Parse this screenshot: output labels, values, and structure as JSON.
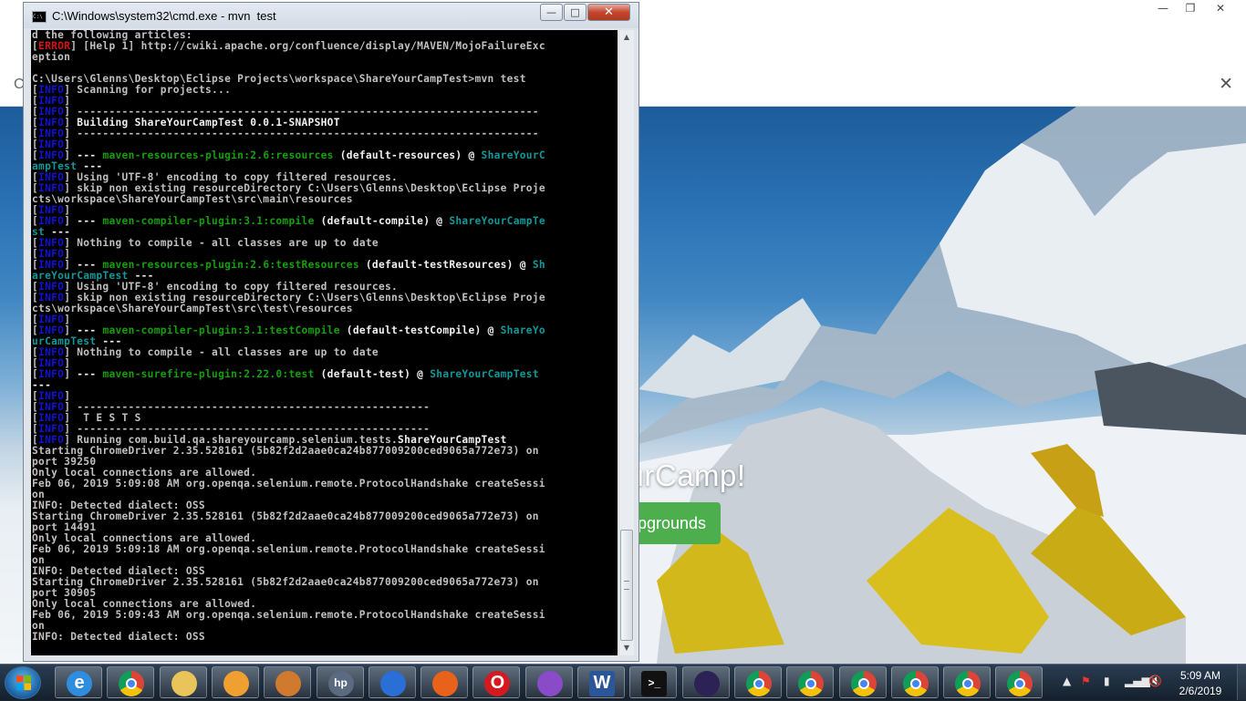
{
  "chrome": {
    "hero_title": "areYourCamp!",
    "hero_button": "pgrounds"
  },
  "cmd": {
    "title": "C:\\Windows\\system32\\cmd.exe - mvn  test",
    "lines": [
      [
        {
          "t": "d the following articles:"
        }
      ],
      [
        {
          "t": "["
        },
        {
          "c": "err",
          "t": "ERROR"
        },
        {
          "t": "] [Help 1] http://cwiki.apache.org/confluence/display/MAVEN/MojoFailureExc"
        }
      ],
      [
        {
          "t": "eption"
        }
      ],
      [
        {
          "t": ""
        }
      ],
      [
        {
          "t": "C:\\Users\\Glenns\\Desktop\\Eclipse Projects\\workspace\\ShareYourCampTest>mvn test"
        }
      ],
      [
        {
          "t": "["
        },
        {
          "c": "info",
          "t": "INFO"
        },
        {
          "t": "] Scanning for projects..."
        }
      ],
      [
        {
          "t": "["
        },
        {
          "c": "info",
          "t": "INFO"
        },
        {
          "t": "]"
        }
      ],
      [
        {
          "t": "["
        },
        {
          "c": "info",
          "t": "INFO"
        },
        {
          "t": "] ------------------------------------------------------------------------"
        }
      ],
      [
        {
          "t": "["
        },
        {
          "c": "info",
          "t": "INFO"
        },
        {
          "t": "] "
        },
        {
          "c": "white",
          "t": "Building ShareYourCampTest 0.0.1-SNAPSHOT"
        }
      ],
      [
        {
          "t": "["
        },
        {
          "c": "info",
          "t": "INFO"
        },
        {
          "t": "] ------------------------------------------------------------------------"
        }
      ],
      [
        {
          "t": "["
        },
        {
          "c": "info",
          "t": "INFO"
        },
        {
          "t": "]"
        }
      ],
      [
        {
          "t": "["
        },
        {
          "c": "info",
          "t": "INFO"
        },
        {
          "t": "] "
        },
        {
          "c": "white",
          "t": "--- "
        },
        {
          "c": "green",
          "t": "maven-resources-plugin:2.6:resources"
        },
        {
          "c": "white",
          "t": " (default-resources) @ "
        },
        {
          "c": "cyan",
          "t": "ShareYourC"
        }
      ],
      [
        {
          "c": "cyan",
          "t": "ampTest"
        },
        {
          "c": "white",
          "t": " ---"
        }
      ],
      [
        {
          "t": "["
        },
        {
          "c": "info",
          "t": "INFO"
        },
        {
          "t": "] Using 'UTF-8' encoding to copy filtered resources."
        }
      ],
      [
        {
          "t": "["
        },
        {
          "c": "info",
          "t": "INFO"
        },
        {
          "t": "] skip non existing resourceDirectory C:\\Users\\Glenns\\Desktop\\Eclipse Proje"
        }
      ],
      [
        {
          "t": "cts\\workspace\\ShareYourCampTest\\src\\main\\resources"
        }
      ],
      [
        {
          "t": "["
        },
        {
          "c": "info",
          "t": "INFO"
        },
        {
          "t": "]"
        }
      ],
      [
        {
          "t": "["
        },
        {
          "c": "info",
          "t": "INFO"
        },
        {
          "t": "] "
        },
        {
          "c": "white",
          "t": "--- "
        },
        {
          "c": "green",
          "t": "maven-compiler-plugin:3.1:compile"
        },
        {
          "c": "white",
          "t": " (default-compile) @ "
        },
        {
          "c": "cyan",
          "t": "ShareYourCampTe"
        }
      ],
      [
        {
          "c": "cyan",
          "t": "st"
        },
        {
          "c": "white",
          "t": " ---"
        }
      ],
      [
        {
          "t": "["
        },
        {
          "c": "info",
          "t": "INFO"
        },
        {
          "t": "] Nothing to compile - all classes are up to date"
        }
      ],
      [
        {
          "t": "["
        },
        {
          "c": "info",
          "t": "INFO"
        },
        {
          "t": "]"
        }
      ],
      [
        {
          "t": "["
        },
        {
          "c": "info",
          "t": "INFO"
        },
        {
          "t": "] "
        },
        {
          "c": "white",
          "t": "--- "
        },
        {
          "c": "green",
          "t": "maven-resources-plugin:2.6:testResources"
        },
        {
          "c": "white",
          "t": " (default-testResources) @ "
        },
        {
          "c": "cyan",
          "t": "Sh"
        }
      ],
      [
        {
          "c": "cyan",
          "t": "areYourCampTest"
        },
        {
          "c": "white",
          "t": " ---"
        }
      ],
      [
        {
          "t": "["
        },
        {
          "c": "info",
          "t": "INFO"
        },
        {
          "t": "] Using 'UTF-8' encoding to copy filtered resources."
        }
      ],
      [
        {
          "t": "["
        },
        {
          "c": "info",
          "t": "INFO"
        },
        {
          "t": "] skip non existing resourceDirectory C:\\Users\\Glenns\\Desktop\\Eclipse Proje"
        }
      ],
      [
        {
          "t": "cts\\workspace\\ShareYourCampTest\\src\\test\\resources"
        }
      ],
      [
        {
          "t": "["
        },
        {
          "c": "info",
          "t": "INFO"
        },
        {
          "t": "]"
        }
      ],
      [
        {
          "t": "["
        },
        {
          "c": "info",
          "t": "INFO"
        },
        {
          "t": "] "
        },
        {
          "c": "white",
          "t": "--- "
        },
        {
          "c": "green",
          "t": "maven-compiler-plugin:3.1:testCompile"
        },
        {
          "c": "white",
          "t": " (default-testCompile) @ "
        },
        {
          "c": "cyan",
          "t": "ShareYo"
        }
      ],
      [
        {
          "c": "cyan",
          "t": "urCampTest"
        },
        {
          "c": "white",
          "t": " ---"
        }
      ],
      [
        {
          "t": "["
        },
        {
          "c": "info",
          "t": "INFO"
        },
        {
          "t": "] Nothing to compile - all classes are up to date"
        }
      ],
      [
        {
          "t": "["
        },
        {
          "c": "info",
          "t": "INFO"
        },
        {
          "t": "]"
        }
      ],
      [
        {
          "t": "["
        },
        {
          "c": "info",
          "t": "INFO"
        },
        {
          "t": "] "
        },
        {
          "c": "white",
          "t": "--- "
        },
        {
          "c": "green",
          "t": "maven-surefire-plugin:2.22.0:test"
        },
        {
          "c": "white",
          "t": " (default-test) @ "
        },
        {
          "c": "cyan",
          "t": "ShareYourCampTest"
        }
      ],
      [
        {
          "c": "white",
          "t": "---"
        }
      ],
      [
        {
          "t": "["
        },
        {
          "c": "info",
          "t": "INFO"
        },
        {
          "t": "]"
        }
      ],
      [
        {
          "t": "["
        },
        {
          "c": "info",
          "t": "INFO"
        },
        {
          "t": "] -------------------------------------------------------"
        }
      ],
      [
        {
          "t": "["
        },
        {
          "c": "info",
          "t": "INFO"
        },
        {
          "t": "]  T E S T S"
        }
      ],
      [
        {
          "t": "["
        },
        {
          "c": "info",
          "t": "INFO"
        },
        {
          "t": "] -------------------------------------------------------"
        }
      ],
      [
        {
          "t": "["
        },
        {
          "c": "info",
          "t": "INFO"
        },
        {
          "t": "] Running com.build.qa.shareyourcamp.selenium.tests."
        },
        {
          "c": "white",
          "t": "ShareYourCampTest"
        }
      ],
      [
        {
          "t": "Starting ChromeDriver 2.35.528161 (5b82f2d2aae0ca24b877009200ced9065a772e73) on"
        }
      ],
      [
        {
          "t": "port 39250"
        }
      ],
      [
        {
          "t": "Only local connections are allowed."
        }
      ],
      [
        {
          "t": "Feb 06, 2019 5:09:08 AM org.openqa.selenium.remote.ProtocolHandshake createSessi"
        }
      ],
      [
        {
          "t": "on"
        }
      ],
      [
        {
          "t": "INFO: Detected dialect: OSS"
        }
      ],
      [
        {
          "t": "Starting ChromeDriver 2.35.528161 (5b82f2d2aae0ca24b877009200ced9065a772e73) on"
        }
      ],
      [
        {
          "t": "port 14491"
        }
      ],
      [
        {
          "t": "Only local connections are allowed."
        }
      ],
      [
        {
          "t": "Feb 06, 2019 5:09:18 AM org.openqa.selenium.remote.ProtocolHandshake createSessi"
        }
      ],
      [
        {
          "t": "on"
        }
      ],
      [
        {
          "t": "INFO: Detected dialect: OSS"
        }
      ],
      [
        {
          "t": "Starting ChromeDriver 2.35.528161 (5b82f2d2aae0ca24b877009200ced9065a772e73) on"
        }
      ],
      [
        {
          "t": "port 30905"
        }
      ],
      [
        {
          "t": "Only local connections are allowed."
        }
      ],
      [
        {
          "t": "Feb 06, 2019 5:09:43 AM org.openqa.selenium.remote.ProtocolHandshake createSessi"
        }
      ],
      [
        {
          "t": "on"
        }
      ],
      [
        {
          "t": "INFO: Detected dialect: OSS"
        }
      ],
      [
        {
          "t": ""
        }
      ],
      [
        {
          "cur": true,
          "t": ""
        }
      ]
    ]
  },
  "taskbar": {
    "clock_time": "5:09 AM",
    "clock_date": "2/6/2019",
    "items": [
      {
        "name": "internet-explorer-icon",
        "color": "#2f8de0",
        "glyph": "e"
      },
      {
        "name": "chrome-icon",
        "color": "chrome",
        "glyph": ""
      },
      {
        "name": "file-explorer-icon",
        "color": "#e8c45a",
        "glyph": ""
      },
      {
        "name": "media-player-icon",
        "color": "#f0a030",
        "glyph": ""
      },
      {
        "name": "remote-desktop-icon",
        "color": "#d07a30",
        "glyph": ""
      },
      {
        "name": "hp-icon",
        "color": "#5a6a80",
        "glyph": "hp"
      },
      {
        "name": "firefox-blue-icon",
        "color": "#2a6fd6",
        "glyph": ""
      },
      {
        "name": "firefox-icon",
        "color": "#e8621b",
        "glyph": ""
      },
      {
        "name": "opera-icon",
        "color": "#d41a20",
        "glyph": "O"
      },
      {
        "name": "colorful-app-icon",
        "color": "#8a4bc8",
        "glyph": ""
      },
      {
        "name": "word-icon",
        "color": "#2b579a",
        "glyph": "W"
      },
      {
        "name": "command-prompt-icon",
        "color": "#111",
        "glyph": ">_"
      },
      {
        "name": "eclipse-icon",
        "color": "#2c2255",
        "glyph": ""
      },
      {
        "name": "chrome-icon",
        "color": "chrome",
        "glyph": ""
      },
      {
        "name": "chrome-icon",
        "color": "chrome",
        "glyph": ""
      },
      {
        "name": "chrome-icon",
        "color": "chrome",
        "glyph": ""
      },
      {
        "name": "chrome-icon",
        "color": "chrome",
        "glyph": ""
      },
      {
        "name": "chrome-icon",
        "color": "chrome",
        "glyph": ""
      },
      {
        "name": "chrome-icon",
        "color": "chrome",
        "glyph": ""
      }
    ]
  }
}
